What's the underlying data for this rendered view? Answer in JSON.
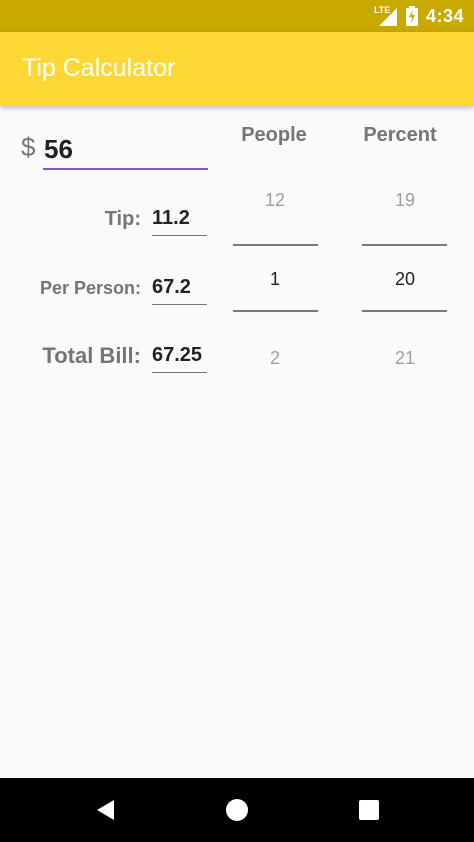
{
  "status_bar": {
    "network": "LTE",
    "time": "4:34"
  },
  "app": {
    "title": "Tip Calculator"
  },
  "bill": {
    "currency_symbol": "$",
    "amount": "56"
  },
  "results": {
    "tip_label": "Tip:",
    "tip_value": "11.2",
    "per_person_label": "Per Person:",
    "per_person_value": "67.2",
    "total_label": "Total Bill:",
    "total_value": "67.25"
  },
  "pickers": {
    "people": {
      "header": "People",
      "above": "12",
      "selected": "1",
      "below": "2"
    },
    "percent": {
      "header": "Percent",
      "above": "19",
      "selected": "20",
      "below": "21"
    }
  },
  "nav": {
    "back": "back-icon",
    "home": "home-icon",
    "recents": "recents-icon"
  },
  "colors": {
    "appbar": "#fdd835",
    "statusbar": "#c9a800",
    "accent": "#7e57c2"
  }
}
